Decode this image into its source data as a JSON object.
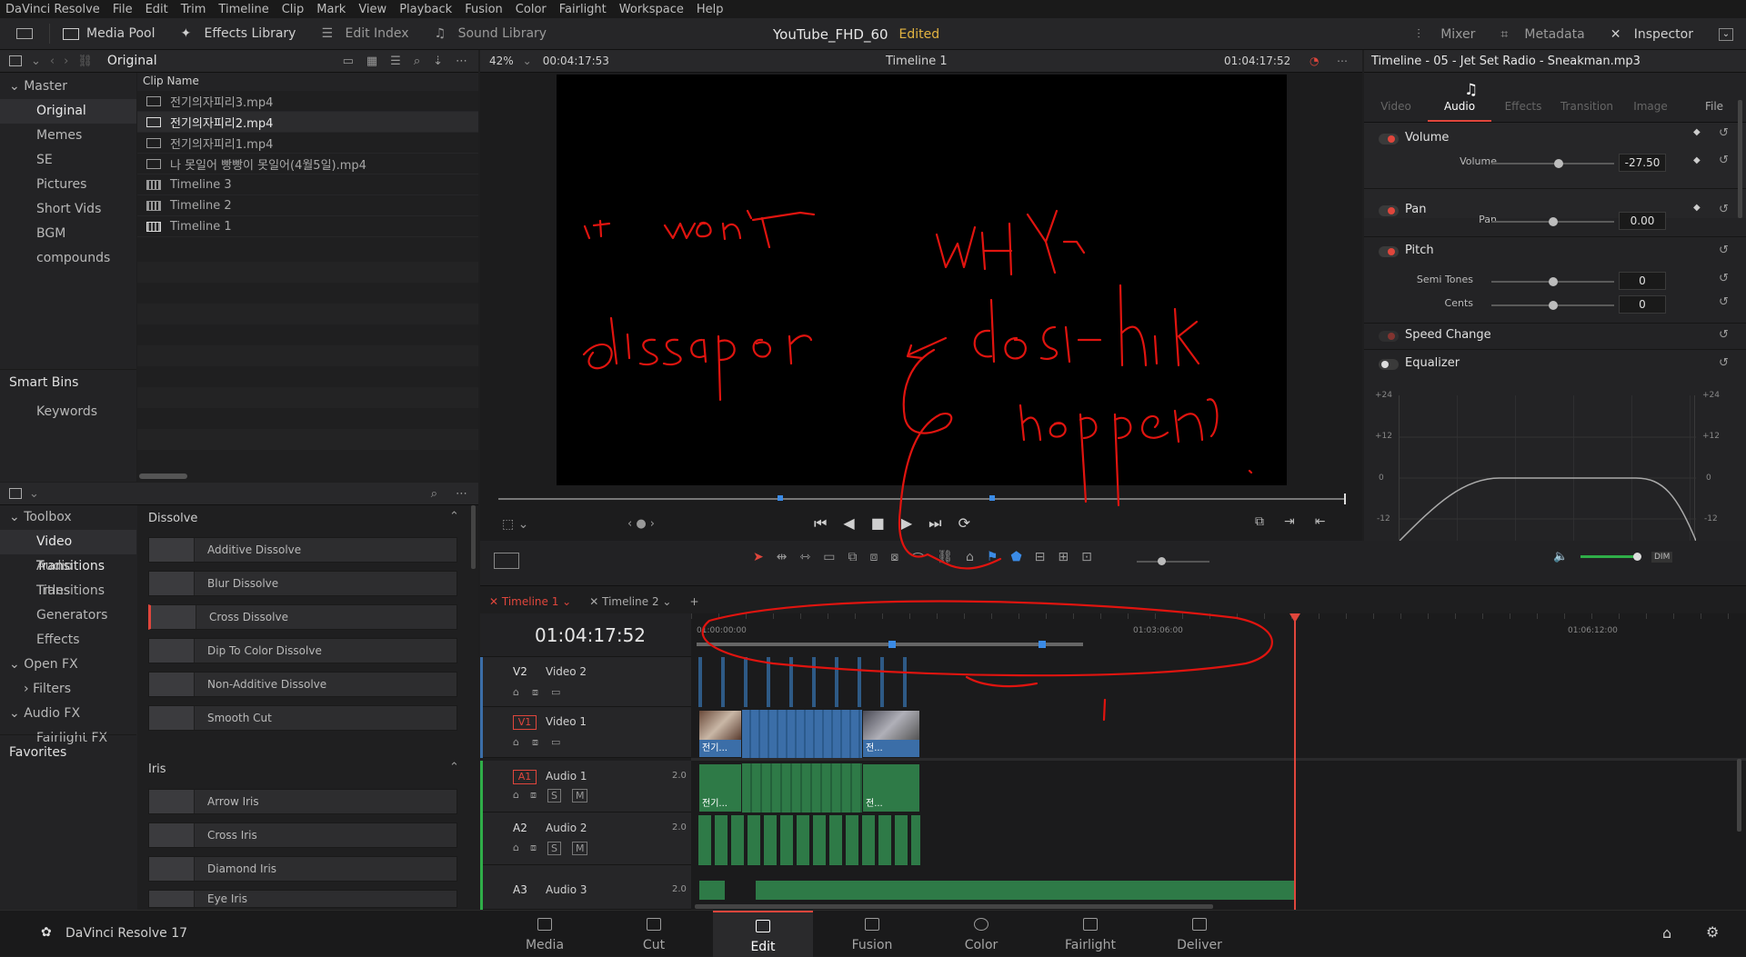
{
  "menu": [
    "DaVinci Resolve",
    "File",
    "Edit",
    "Trim",
    "Timeline",
    "Clip",
    "Mark",
    "View",
    "Playback",
    "Fusion",
    "Color",
    "Fairlight",
    "Workspace",
    "Help"
  ],
  "toolbar": {
    "media_pool": "Media Pool",
    "effects_library": "Effects Library",
    "edit_index": "Edit Index",
    "sound_library": "Sound Library",
    "project": "YouTube_FHD_60",
    "edited": "Edited",
    "mixer": "Mixer",
    "metadata": "Metadata",
    "inspector": "Inspector"
  },
  "bins": {
    "header": "Original",
    "master": "Master",
    "items": [
      "Original",
      "Memes",
      "SE",
      "Pictures",
      "Short Vids",
      "BGM",
      "compounds"
    ],
    "smart_bins": "Smart Bins",
    "keywords": "Keywords"
  },
  "clips": {
    "column": "Clip Name",
    "items": [
      "전기의자피리3.mp4",
      "전기의자피리2.mp4",
      "전기의자피리1.mp4",
      "나 못일어 빵빵이 못일어(4월5일).mp4",
      "Timeline 3",
      "Timeline 2",
      "Timeline 1"
    ]
  },
  "viewer": {
    "zoom": "42%",
    "source_tc": "00:04:17:53",
    "timeline_name": "Timeline 1",
    "record_tc": "01:04:17:52"
  },
  "inspector": {
    "title": "Timeline - 05 - Jet Set Radio - Sneakman.mp3",
    "tabs": [
      "Video",
      "Audio",
      "Effects",
      "Transition",
      "Image",
      "File"
    ],
    "active_tab": "Audio",
    "volume": "Volume",
    "volume_label": "Volume",
    "volume_value": "-27.50",
    "pan": "Pan",
    "pan_label": "Pan",
    "pan_value": "0.00",
    "pitch": "Pitch",
    "semitones_label": "Semi Tones",
    "semitones_value": "0",
    "cents_label": "Cents",
    "cents_value": "0",
    "speed_change": "Speed Change",
    "equalizer": "Equalizer",
    "eq_db": [
      "+24",
      "+12",
      "0",
      "-12"
    ]
  },
  "fx": {
    "toolbox": "Toolbox",
    "video_transitions": "Video Transitions",
    "audio_transitions": "Audio Transitions",
    "titles": "Titles",
    "generators": "Generators",
    "effects": "Effects",
    "open_fx": "Open FX",
    "filters": "Filters",
    "audio_fx": "Audio FX",
    "fairlight_fx": "Fairlight FX",
    "favorites": "Favorites",
    "dissolve_header": "Dissolve",
    "dissolve": [
      "Additive Dissolve",
      "Blur Dissolve",
      "Cross Dissolve",
      "Dip To Color Dissolve",
      "Non-Additive Dissolve",
      "Smooth Cut"
    ],
    "iris_header": "Iris",
    "iris": [
      "Arrow Iris",
      "Cross Iris",
      "Diamond Iris",
      "Eye Iris"
    ]
  },
  "timeline": {
    "tabs": [
      "Timeline 1",
      "Timeline 2"
    ],
    "timecode": "01:04:17:52",
    "ruler": [
      "01:00:00:00",
      "01:03:06:00",
      "01:06:12:00"
    ],
    "tracks": [
      {
        "id": "V2",
        "name": "Video 2",
        "ch": ""
      },
      {
        "id": "V1",
        "name": "Video 1",
        "ch": ""
      },
      {
        "id": "A1",
        "name": "Audio 1",
        "ch": "2.0"
      },
      {
        "id": "A2",
        "name": "Audio 2",
        "ch": "2.0"
      },
      {
        "id": "A3",
        "name": "Audio 3",
        "ch": "2.0"
      }
    ],
    "clip_label_v": "전기...",
    "clip_label_v2": "전...",
    "clip_label_a": "전기...",
    "clip_label_a2": "전...",
    "solo": "S",
    "mute": "M"
  },
  "pages": {
    "app": "DaVinci Resolve 17",
    "items": [
      "Media",
      "Cut",
      "Edit",
      "Fusion",
      "Color",
      "Fairlight",
      "Deliver"
    ],
    "active": "Edit"
  },
  "annotation": {
    "text": "it won't dissapear WHY does this happen",
    "color": "#e0140f"
  }
}
